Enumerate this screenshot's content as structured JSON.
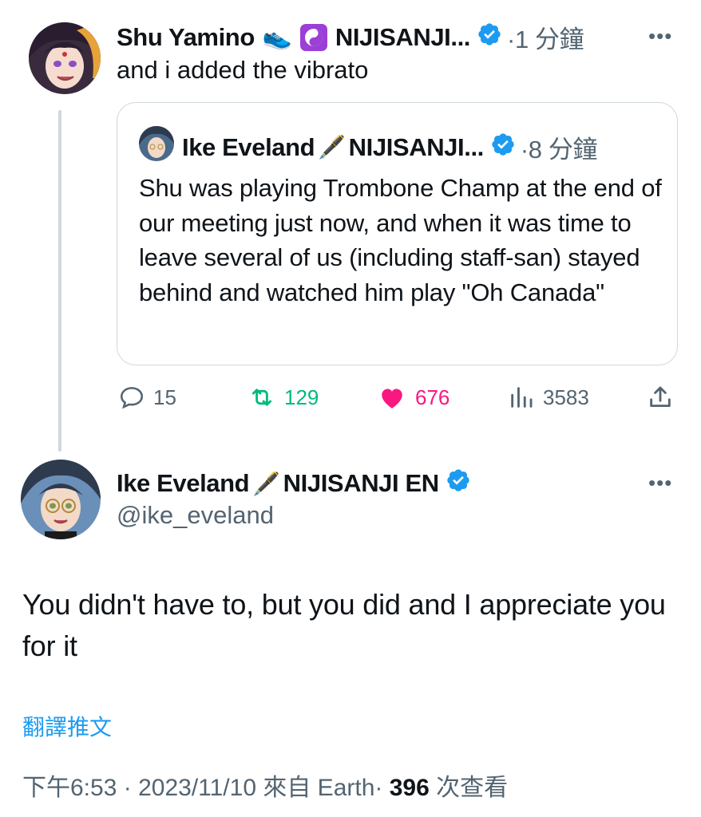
{
  "parent_tweet": {
    "author_name": "Shu Yamino",
    "emoji_1": "👟",
    "emoji_2": "☯️",
    "org_truncated": "NIJISANJI...",
    "time": "·1 分鐘",
    "text": "and i added the vibrato",
    "more_label": "•••",
    "quote": {
      "author_name": "Ike Eveland",
      "emoji": "🖋️",
      "org_truncated": "NIJISANJI...",
      "time": "·8 分鐘",
      "text": "Shu was playing Trombone Champ at the end of our meeting just now, and when it was time to leave several of us (including staff-san) stayed behind and watched him play \"Oh Canada\""
    },
    "actions": {
      "replies": "15",
      "retweets": "129",
      "likes": "676",
      "views": "3583"
    }
  },
  "main_tweet": {
    "author_name": "Ike Eveland",
    "emoji": "🖋️",
    "org": "NIJISANJI EN",
    "handle": "@ike_eveland",
    "more_label": "•••",
    "text": "You didn't have to, but you did and I appreciate you for it",
    "translate_label": "翻譯推文",
    "time": "下午6:53",
    "sep1": "·",
    "date": "2023/11/10",
    "source": "來自 Earth",
    "sep2": "·",
    "views_count": "396",
    "views_label": "次查看"
  },
  "colors": {
    "verified": "#1d9bf0",
    "retweet": "#00ba7c",
    "like": "#f91880",
    "link": "#1d9bf0",
    "muted": "#536471"
  }
}
